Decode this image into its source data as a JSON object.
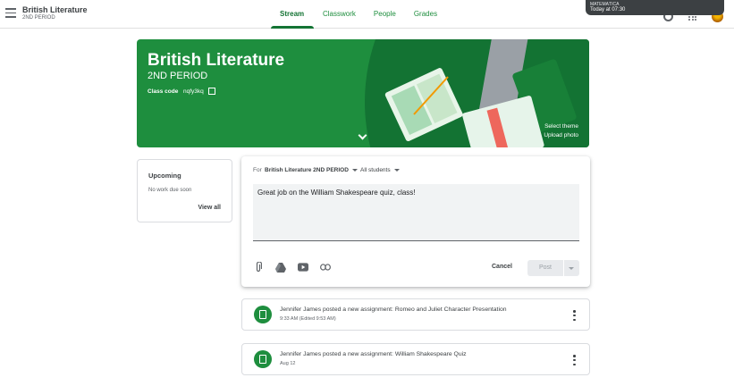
{
  "header": {
    "class_name": "British Literature",
    "class_section": "2ND PERIOD",
    "tabs": [
      {
        "label": "Stream"
      },
      {
        "label": "Classwork"
      },
      {
        "label": "People"
      },
      {
        "label": "Grades"
      }
    ],
    "active_tab": "Stream"
  },
  "notification": {
    "title": "MATEMÁTICA",
    "time": "Today at 07:30"
  },
  "banner": {
    "title": "British Literature",
    "section": "2ND PERIOD",
    "code_label": "Class code",
    "code_value": "nqfy3kq",
    "select_theme": "Select theme",
    "upload_photo": "Upload photo",
    "color": "#1e8e3e"
  },
  "upcoming": {
    "title": "Upcoming",
    "empty_text": "No work due soon",
    "view_all": "View all"
  },
  "composer": {
    "for_label": "For",
    "class_select": "British Literature 2ND PERIOD",
    "audience_select": "All students",
    "text": "Great job on the William Shakespeare quiz, class!",
    "cancel_label": "Cancel",
    "post_label": "Post"
  },
  "posts": [
    {
      "title": "Jennifer James posted a new assignment: Romeo and Juliet Character Presentation",
      "date": "9:33 AM (Edited 9:53 AM)"
    },
    {
      "title": "Jennifer James posted a new assignment: William Shakespeare Quiz",
      "date": "Aug 12"
    }
  ]
}
